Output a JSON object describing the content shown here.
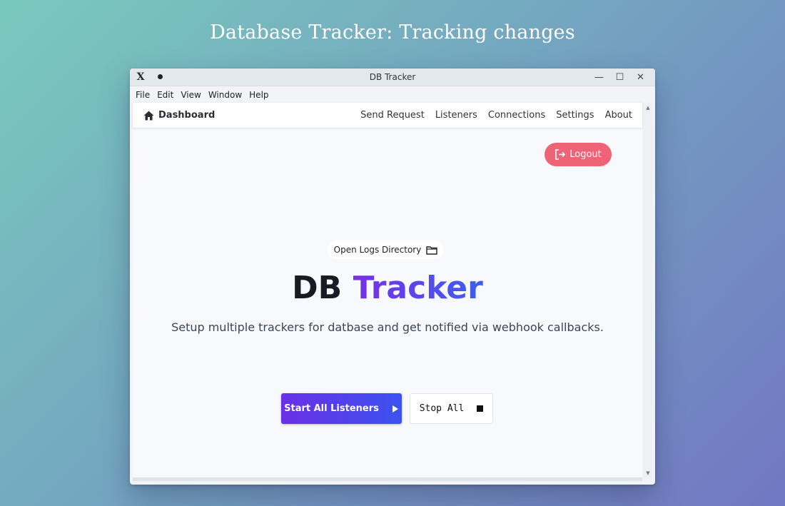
{
  "page": {
    "headline": "Database Tracker: Tracking changes"
  },
  "window": {
    "title": "DB Tracker",
    "controls": {
      "minimize": "—",
      "maximize": "☐",
      "close": "✕"
    }
  },
  "menu": {
    "items": [
      "File",
      "Edit",
      "View",
      "Window",
      "Help"
    ]
  },
  "navbar": {
    "brand": "Dashboard",
    "links": [
      "Send Request",
      "Listeners",
      "Connections",
      "Settings",
      "About"
    ]
  },
  "actions": {
    "logout": "Logout",
    "open_logs": "Open Logs Directory",
    "start_all": "Start All Listeners",
    "stop_all": "Stop All"
  },
  "hero": {
    "title_plain": "DB",
    "title_accent": "Tracker",
    "subtitle": "Setup multiple trackers for datbase and get notified via webhook callbacks."
  },
  "colors": {
    "logout_bg": "#ef6377",
    "accent_start": "#6a2fe6",
    "accent_end": "#3c52f0"
  }
}
